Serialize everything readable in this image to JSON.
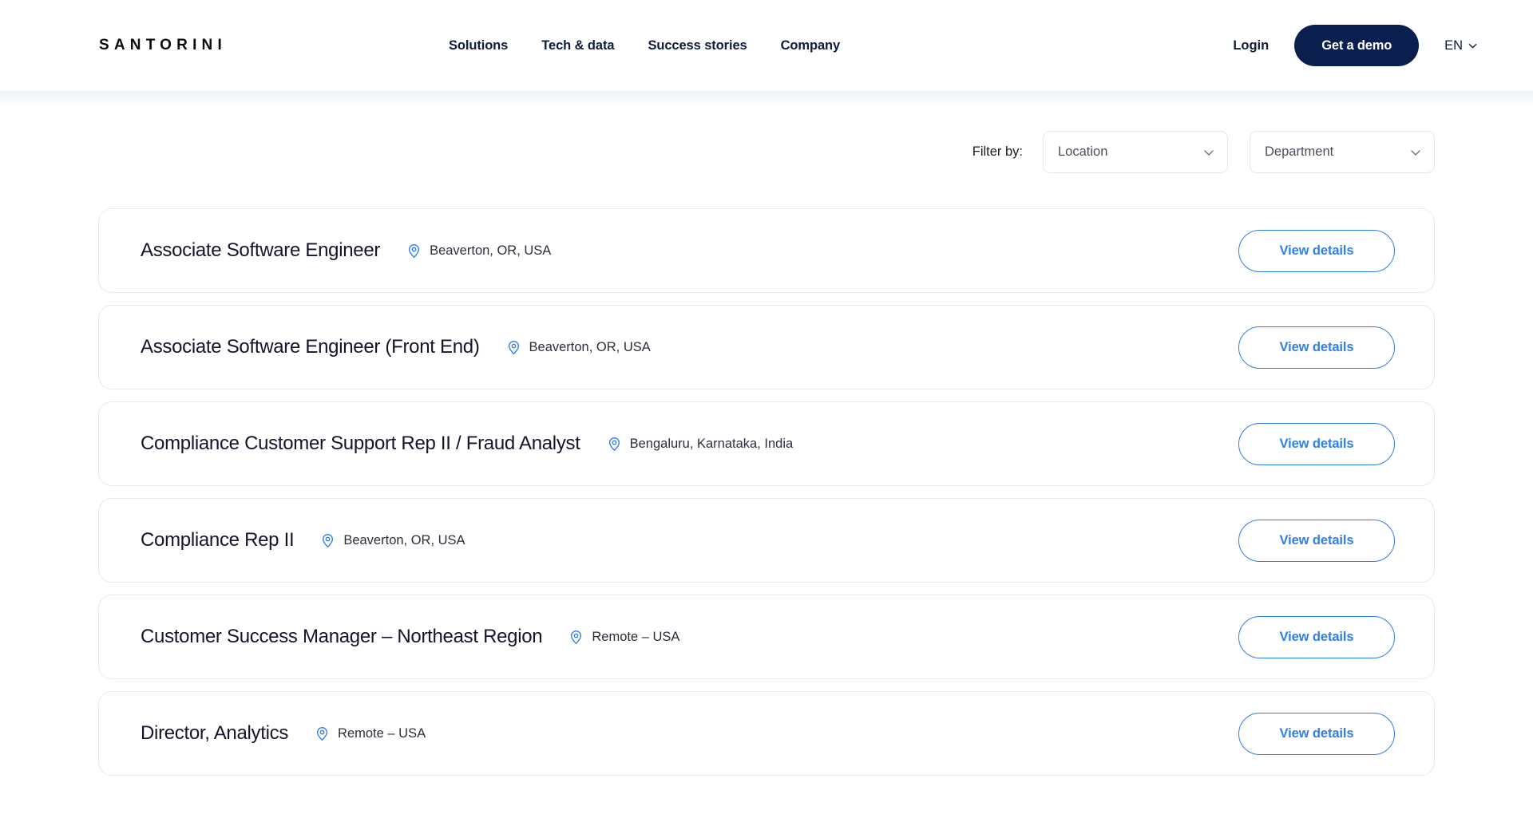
{
  "header": {
    "logo": "SANTORINI",
    "nav": [
      {
        "label": "Solutions"
      },
      {
        "label": "Tech & data"
      },
      {
        "label": "Success stories"
      },
      {
        "label": "Company"
      }
    ],
    "login_label": "Login",
    "demo_label": "Get a demo",
    "language": "EN"
  },
  "filters": {
    "label": "Filter by:",
    "location": {
      "value": "Location"
    },
    "department": {
      "value": "Department"
    }
  },
  "jobs": {
    "view_details_label": "View details",
    "items": [
      {
        "title": "Associate Software Engineer",
        "location": "Beaverton, OR, USA"
      },
      {
        "title": "Associate Software Engineer (Front End)",
        "location": "Beaverton, OR, USA"
      },
      {
        "title": "Compliance Customer Support Rep II / Fraud Analyst",
        "location": "Bengaluru, Karnataka, India"
      },
      {
        "title": "Compliance Rep II",
        "location": "Beaverton, OR, USA"
      },
      {
        "title": "Customer Success Manager – Northeast Region",
        "location": "Remote – USA"
      },
      {
        "title": "Director, Analytics",
        "location": "Remote – USA"
      }
    ]
  },
  "colors": {
    "brand_navy": "#0a1f4d",
    "accent_blue": "#2f7fe8",
    "text_dark": "#14142b",
    "card_border": "#e8e9ed"
  }
}
